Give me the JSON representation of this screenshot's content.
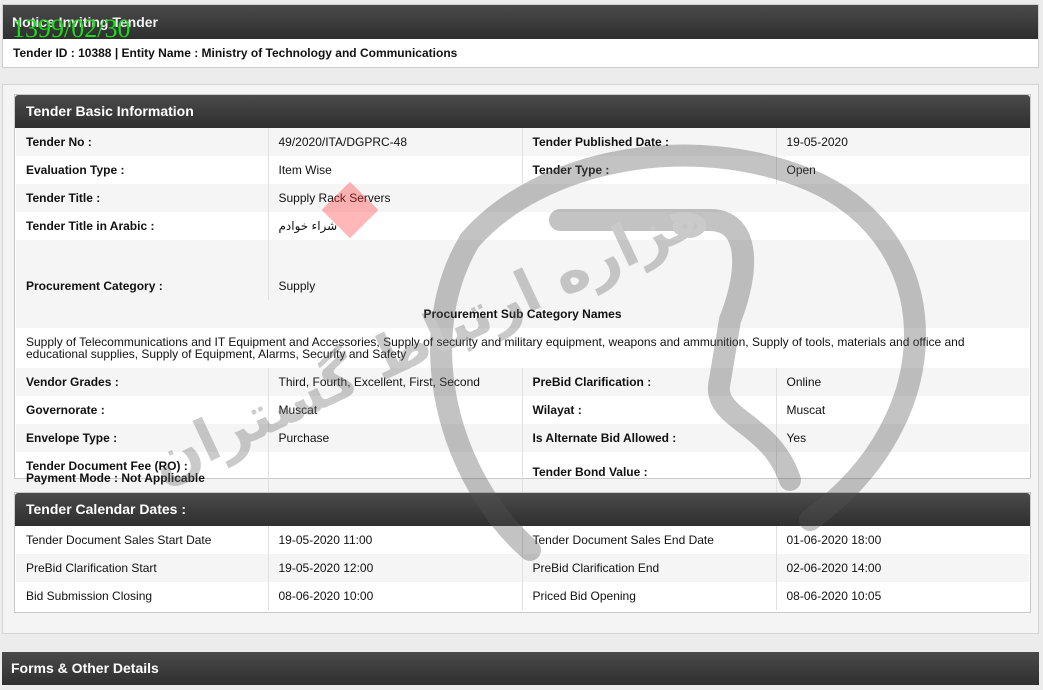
{
  "stamp": "1399/02/30",
  "notice": {
    "title": "Notice Inviting Tender",
    "subtitle": "Tender ID : 10388 | Entity Name : Ministry of Technology and Communications"
  },
  "basic": {
    "header": "Tender Basic Information",
    "tender_no_label": "Tender No :",
    "tender_no": "49/2020/ITA/DGPRC-48",
    "published_label": "Tender Published Date :",
    "published": "19-05-2020",
    "eval_label": "Evaluation Type :",
    "eval": "Item Wise",
    "type_label": "Tender Type :",
    "type": "Open",
    "title_label": "Tender Title :",
    "title": "Supply Rack Servers",
    "arabic_label": "Tender Title in Arabic :",
    "arabic": "شراء خوادم",
    "category_label": "Procurement Category :",
    "category": "Supply",
    "subcat_header": "Procurement Sub Category Names",
    "subcats": "Supply of Telecommunications and IT Equipment and Accessories, Supply of security and military equipment, weapons and ammunition, Supply of tools, materials and office and educational supplies, Supply of Equipment, Alarms, Security and Safety",
    "grades_label": "Vendor Grades :",
    "grades": "Third, Fourth, Excellent, First, Second",
    "prebid_label": "PreBid Clarification :",
    "prebid": "Online",
    "gov_label": "Governorate :",
    "gov": "Muscat",
    "wilayat_label": "Wilayat :",
    "wilayat": "Muscat",
    "envelope_label": "Envelope Type :",
    "envelope": "Purchase",
    "alt_label": "Is Alternate Bid Allowed :",
    "alt": "Yes",
    "fee_label": "Tender Document Fee (RO) :",
    "payment_label": "Payment Mode :  Not Applicable",
    "bond_label": "Tender Bond Value :"
  },
  "calendar": {
    "header": "Tender Calendar Dates :",
    "rows": [
      {
        "l1": "Tender Document Sales Start Date",
        "v1": "19-05-2020 11:00",
        "l2": "Tender Document Sales End Date",
        "v2": "01-06-2020 18:00"
      },
      {
        "l1": "PreBid Clarification Start",
        "v1": "19-05-2020 12:00",
        "l2": "PreBid Clarification End",
        "v2": "02-06-2020 14:00"
      },
      {
        "l1": "Bid Submission Closing",
        "v1": "08-06-2020 10:00",
        "l2": "Priced Bid Opening",
        "v2": "08-06-2020 10:05"
      }
    ]
  },
  "forms": {
    "header": "Forms & Other Details"
  },
  "watermark": {
    "text": "هزاره ارتباط گستران"
  }
}
